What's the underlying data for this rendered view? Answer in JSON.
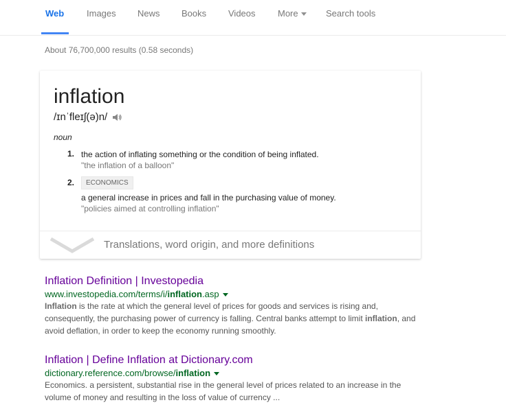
{
  "nav": {
    "tabs": [
      "Web",
      "Images",
      "News",
      "Books",
      "Videos"
    ],
    "more_label": "More",
    "search_tools_label": "Search tools",
    "active_tab": "Web",
    "accent_color": "#1a73e8"
  },
  "results_count": "About 76,700,000 results (0.58 seconds)",
  "definition": {
    "word": "inflation",
    "phonetic": "/ɪnˈfleɪʃ(ə)n/",
    "part_of_speech": "noun",
    "senses": [
      {
        "number": "1.",
        "label": "",
        "text": "the action of inflating something or the condition of being inflated.",
        "example": "\"the inflation of a balloon\""
      },
      {
        "number": "2.",
        "label": "ECONOMICS",
        "text": "a general increase in prices and fall in the purchasing value of money.",
        "example": "\"policies aimed at controlling inflation\""
      }
    ],
    "more_label": "Translations, word origin, and more definitions"
  },
  "results": [
    {
      "title": "Inflation Definition | Investopedia",
      "url_prefix": "www.investopedia.com/terms/i/",
      "url_bold": "inflation",
      "url_suffix": ".asp",
      "snippet_parts": [
        {
          "text": "Inflation",
          "bold": true
        },
        {
          "text": " is the rate at which the general level of prices for goods and services is rising and, consequently, the purchasing power of currency is falling. Central banks attempt to limit ",
          "bold": false
        },
        {
          "text": "inflation",
          "bold": true
        },
        {
          "text": ", and avoid deflation, in order to keep the economy running smoothly.",
          "bold": false
        }
      ],
      "title_color": "#660099",
      "url_color": "#006621"
    },
    {
      "title": "Inflation | Define Inflation at Dictionary.com",
      "url_prefix": "dictionary.reference.com/browse/",
      "url_bold": "inflation",
      "url_suffix": "",
      "snippet_parts": [
        {
          "text": "Economics. a persistent, substantial rise in the general level of prices related to an increase in the volume of money and resulting in the loss of value of currency ...",
          "bold": false
        }
      ],
      "title_color": "#660099",
      "url_color": "#006621"
    }
  ]
}
